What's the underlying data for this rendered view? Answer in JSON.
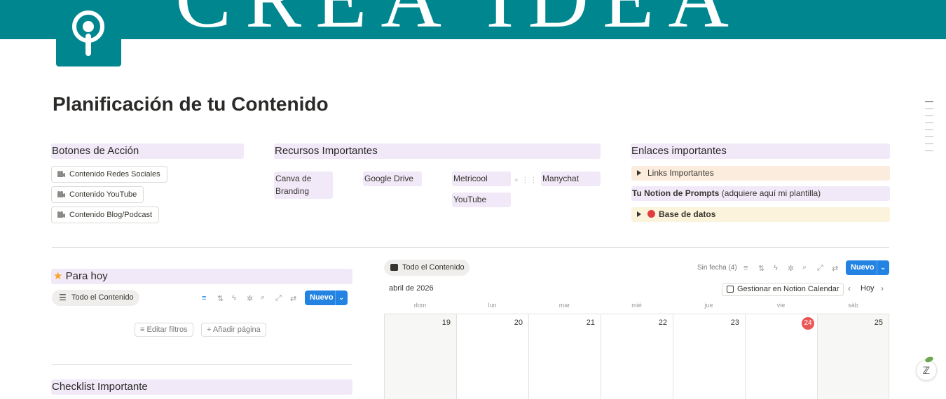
{
  "banner": {
    "text": "CREA IDEA"
  },
  "page": {
    "title": "Planificación de tu Contenido"
  },
  "sections": {
    "botones": {
      "title": "Botones de Acción",
      "buttons": [
        "Contenido Redes Sociales",
        "Contenido YouTube",
        "Contenido Blog/Podcast"
      ]
    },
    "recursos": {
      "title": "Recursos Importantes",
      "tags": [
        "Canva de\nBranding",
        "Google Drive",
        "Metricool",
        "Manychat",
        "YouTube"
      ]
    },
    "enlaces": {
      "title": "Enlaces importantes",
      "toggle1": "Links Importantes",
      "prompts_bold": "Tu Notion de Prompts",
      "prompts_rest": " (adquiere aquí mi plantilla)",
      "toggle2": "Base de datos"
    },
    "para_hoy": {
      "title": "Para hoy",
      "view_label": "Todo el Contenido",
      "new_label": "Nuevo",
      "edit_filters": "Editar filtros",
      "add_page": "Añadir página"
    },
    "checklist": {
      "title": "Checklist Importante"
    }
  },
  "calendar": {
    "view_label": "Todo el Contenido",
    "no_date": "Sin fecha (4)",
    "new_label": "Nuevo",
    "month": "abril de 2026",
    "manage_label": "Gestionar en Notion Calendar",
    "today_label": "Hoy",
    "weekdays": [
      "dom",
      "lun",
      "mar",
      "mié",
      "jue",
      "vie",
      "sáb"
    ],
    "days": [
      "19",
      "20",
      "21",
      "22",
      "23",
      "24",
      "25"
    ],
    "today": "24"
  },
  "colors": {
    "banner": "#00868f",
    "section_header": "#f1e9f8",
    "primary_button": "#2383e2",
    "today_badge": "#eb5757",
    "toggle_links_bg": "#fbecdd",
    "toggle_db_bg": "#fbf3db"
  }
}
